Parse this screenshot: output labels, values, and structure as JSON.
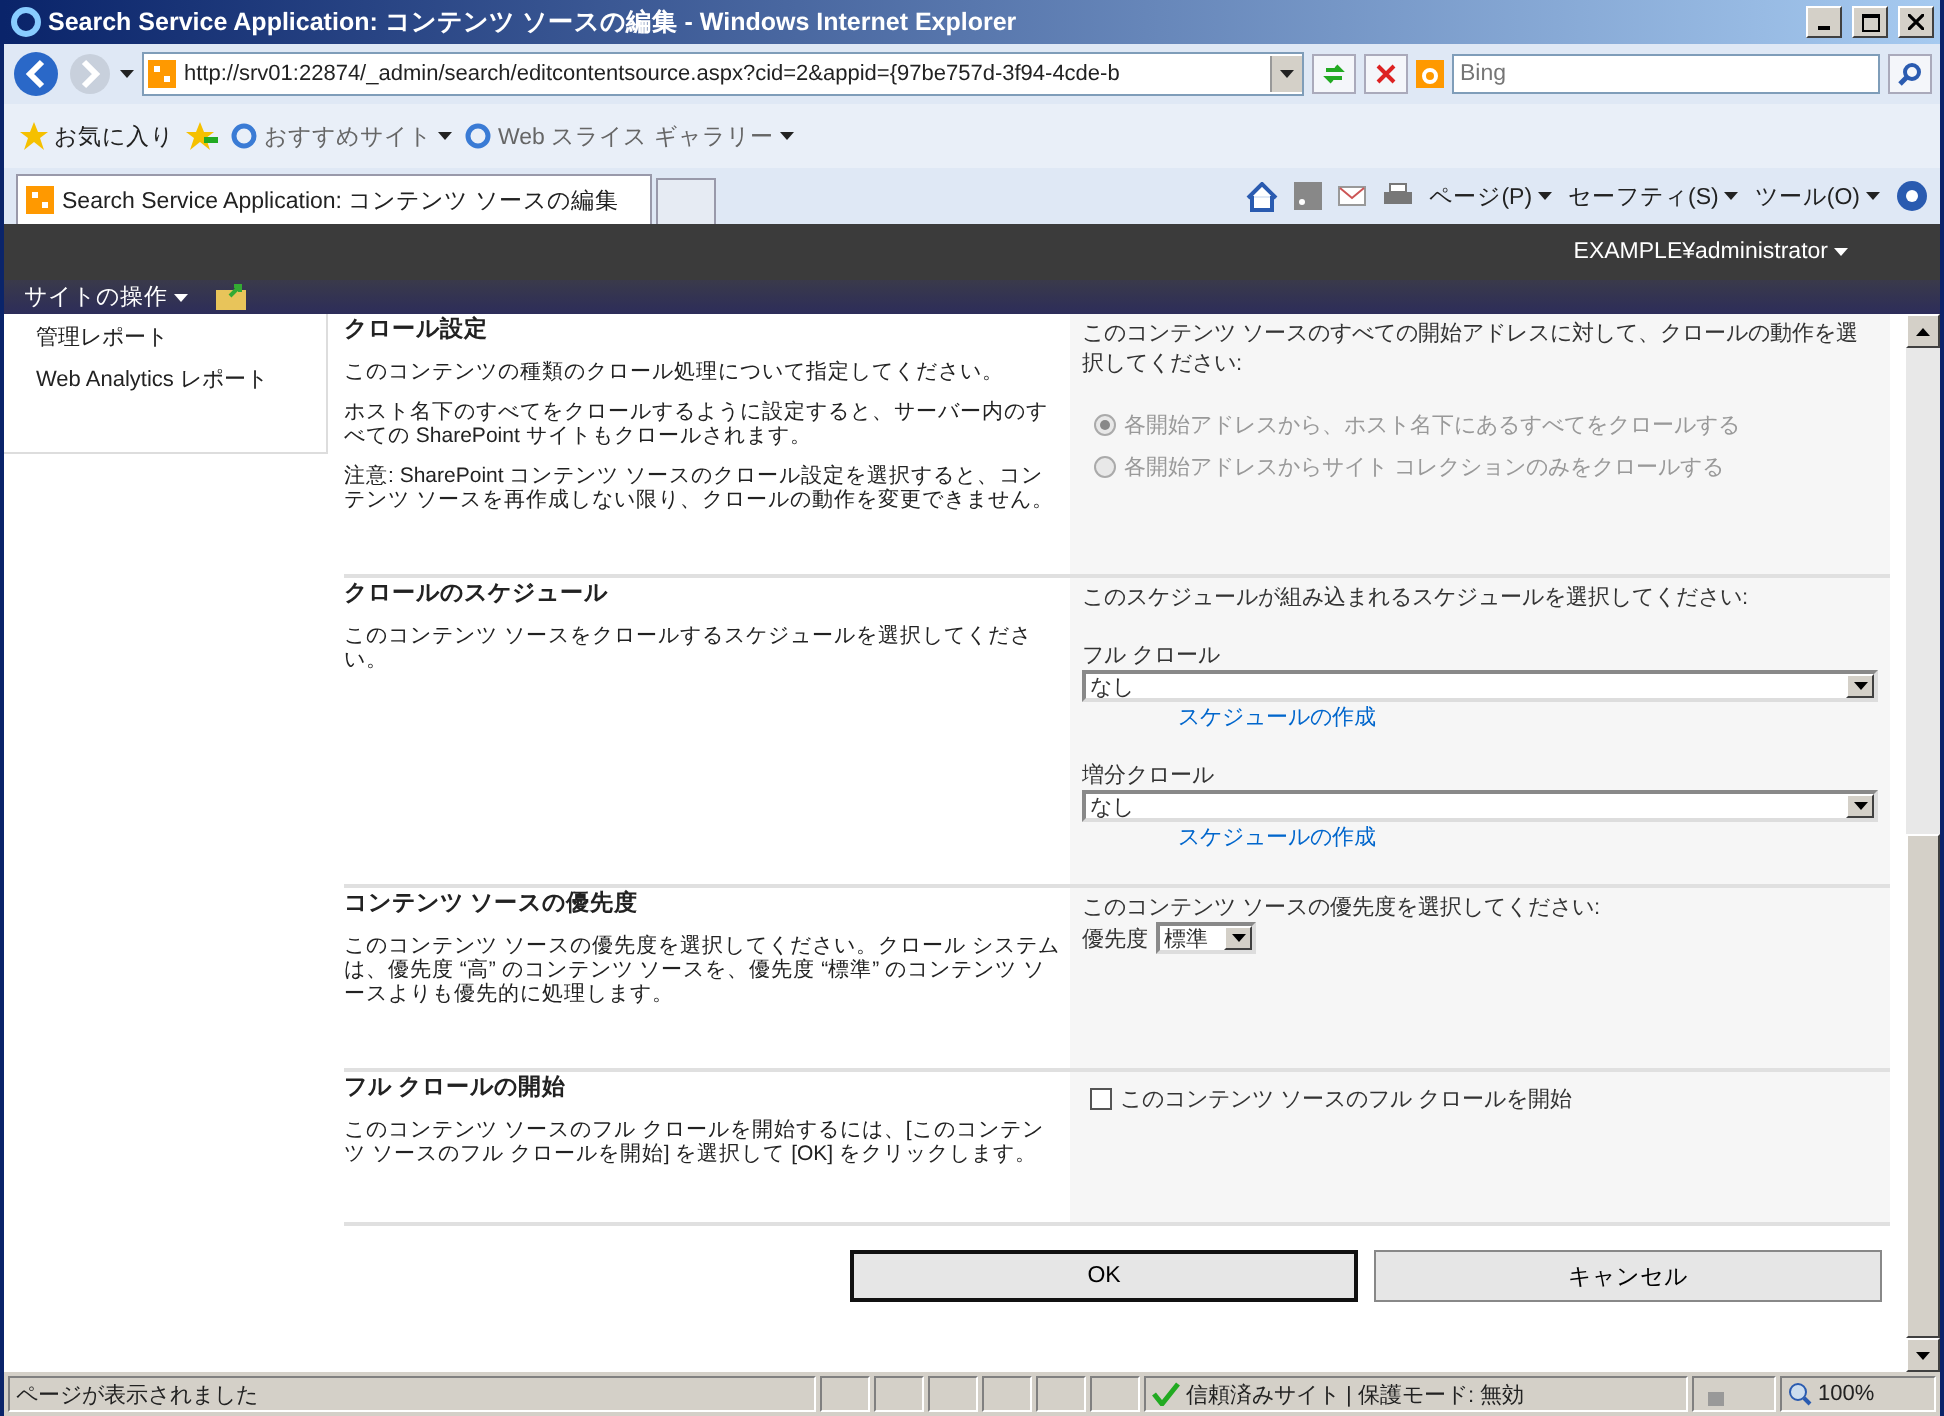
{
  "window": {
    "title": "Search Service Application: コンテンツ ソースの編集 - Windows Internet Explorer"
  },
  "address_bar": {
    "url": "http://srv01:22874/_admin/search/editcontentsource.aspx?cid=2&appid={97be757d-3f94-4cde-b",
    "search_placeholder": "Bing"
  },
  "favorites_bar": {
    "favorites": "お気に入り",
    "items": [
      "おすすめサイト",
      "Web スライス ギャラリー"
    ]
  },
  "tab": {
    "title": "Search Service Application: コンテンツ ソースの編集"
  },
  "command_bar": [
    "ページ(P)",
    "セーフティ(S)",
    "ツール(O)"
  ],
  "sharepoint_bar": {
    "user": "EXAMPLE¥administrator",
    "site_actions": "サイトの操作"
  },
  "sidebar": {
    "items": [
      "管理レポート",
      "Web Analytics レポート"
    ]
  },
  "sections": [
    {
      "kind": "radio",
      "title": "クロール設定",
      "descriptions": [
        "このコンテンツの種類のクロール処理について指定してください。",
        "ホスト名下のすべてをクロールするように設定すると、サーバー内のすべての SharePoint サイトもクロールされます。",
        "注意: SharePoint コンテンツ ソースのクロール設定を選択すると、コンテンツ ソースを再作成しない限り、クロールの動作を変更できません。"
      ],
      "prompt": "このコンテンツ ソースのすべての開始アドレスに対して、クロールの動作を選択してください:",
      "options": [
        {
          "label": "各開始アドレスから、ホスト名下にあるすべてをクロールする",
          "selected": true,
          "disabled": true
        },
        {
          "label": "各開始アドレスからサイト コレクションのみをクロールする",
          "selected": false,
          "disabled": true
        }
      ]
    },
    {
      "kind": "schedules",
      "title": "クロールのスケジュール",
      "descriptions": [
        "このコンテンツ ソースをクロールするスケジュールを選択してください。"
      ],
      "prompt": "このスケジュールが組み込まれるスケジュールを選択してください:",
      "fields": [
        {
          "label": "フル クロール",
          "value": "なし",
          "link": "スケジュールの作成"
        },
        {
          "label": "増分クロール",
          "value": "なし",
          "link": "スケジュールの作成"
        }
      ]
    },
    {
      "kind": "priority",
      "title": "コンテンツ ソースの優先度",
      "descriptions": [
        "このコンテンツ ソースの優先度を選択してください。クロール システムは、優先度 “高” のコンテンツ ソースを、優先度 “標準” のコンテンツ ソースよりも優先的に処理します。"
      ],
      "prompt": "このコンテンツ ソースの優先度を選択してください:",
      "label": "優先度",
      "value": "標準"
    },
    {
      "kind": "checkbox",
      "title": "フル クロールの開始",
      "descriptions": [
        "このコンテンツ ソースのフル クロールを開始するには、[このコンテンツ ソースのフル クロールを開始] を選択して [OK] をクリックします。"
      ],
      "label": "このコンテンツ ソースのフル クロールを開始",
      "checked": false
    }
  ],
  "buttons": [
    {
      "label": "OK",
      "default": true
    },
    {
      "label": "キャンセル",
      "default": false
    }
  ],
  "status_bar": {
    "text": "ページが表示されました",
    "zone": "信頼済みサイト | 保護モード: 無効",
    "zoom": "100%"
  }
}
